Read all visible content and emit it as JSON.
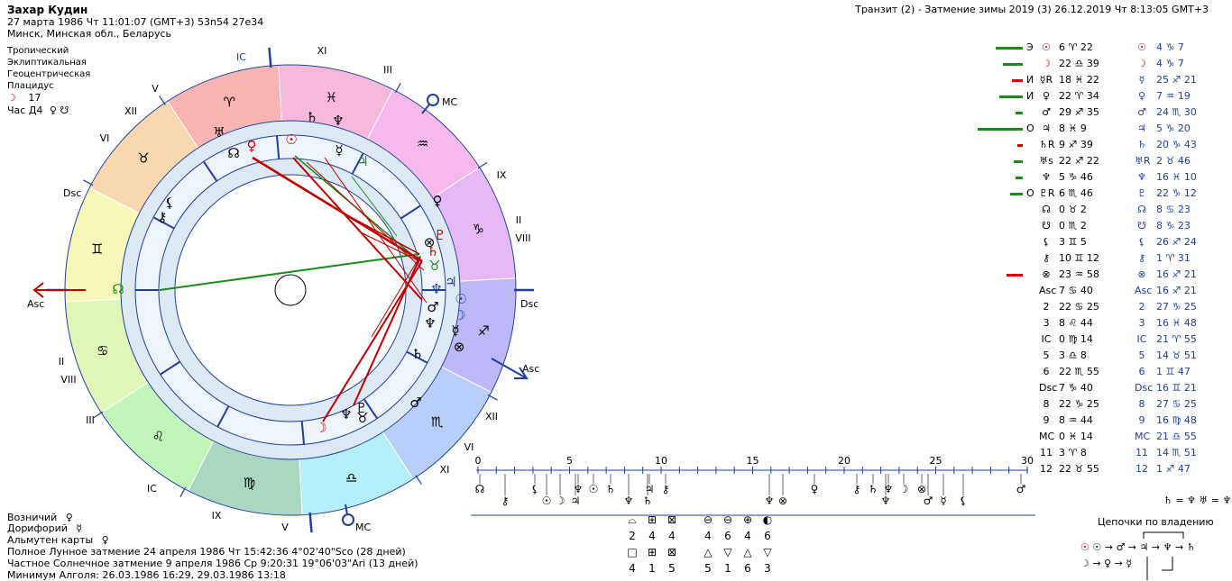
{
  "header": {
    "name": "Захар Кудин",
    "datetime": "27 марта 1986  Чт  11:01:07 (GMT+3) 53n54  27e34",
    "place": "Минск, Минская обл., Беларусь",
    "transit": "Транзит (2) - Затмение зимы 2019 (3) 26.12.2019  Чт  8:13:05 GMT+3"
  },
  "settings": {
    "zodiac": "Тропический",
    "coords": "Эклиптикальная",
    "center": "Геоцентрическая",
    "houses": "Плацидус",
    "moon_glyph": "☽",
    "moon_value": "17",
    "hour_label": "Час Д4",
    "hour_glyphs": "♀ ☋"
  },
  "bottom_info": {
    "ruler_label": "Возничий",
    "ruler_glyph": "♀",
    "doryphory_label": "Дорифорий",
    "doryphory_glyph": "☿",
    "almuten_label": "Альмутен карты",
    "almuten_glyph": "♀",
    "eclipse_lunar": "Полное Лунное затмение 24 апреля 1986 Чт 15:42:36  4°02'40\"Sco (28 дней)",
    "eclipse_solar": "Частное Солнечное затмение 9 апреля 1986 Ср  9:20:31 19°06'03\"Ari (13 дней)",
    "algol": "Минимум Алголя: 26.03.1986 16:29,  29.03.1986 13:18"
  },
  "wheel_labels": {
    "asc_left": "Asc",
    "dsc_left": "Dsc",
    "ic_top": "IC",
    "mc_right": "MC",
    "dsc_right": "Dsc",
    "asc_right": "Asc",
    "ic_bottom": "IC",
    "mc_bottom": "MC",
    "houses_outer": [
      "XI",
      "III",
      "IX",
      "II",
      "VIII",
      "XII",
      "VI",
      "V",
      "IX",
      "III",
      "II",
      "VIII",
      "XII",
      "V",
      "VI",
      "XI",
      "IX"
    ]
  },
  "signs": [
    "♈",
    "♓",
    "♒",
    "♑",
    "♐",
    "♏",
    "♎",
    "♍",
    "♌",
    "♋",
    "♊",
    "♉"
  ],
  "planets_table": [
    {
      "mark": "Э",
      "n_glyph": "☉",
      "n_pos": "6 ♈ 22",
      "t_glyph": "☉",
      "t_pos": "4 ♑ 7"
    },
    {
      "mark": "",
      "n_glyph": "☽",
      "n_pos": "22 ♎ 39",
      "t_glyph": "☽",
      "t_pos": "4 ♑ 7"
    },
    {
      "mark": "И",
      "n_glyph": "☿R",
      "n_pos": "18 ♓ 22",
      "t_glyph": "☿",
      "t_pos": "25 ♐ 21"
    },
    {
      "mark": "И",
      "n_glyph": "♀",
      "n_pos": "22 ♈ 34",
      "t_glyph": "♀",
      "t_pos": "7 ♒ 19"
    },
    {
      "mark": "",
      "n_glyph": "♂",
      "n_pos": "29 ♐ 35",
      "t_glyph": "♂",
      "t_pos": "24 ♏ 30"
    },
    {
      "mark": "О",
      "n_glyph": "♃",
      "n_pos": "8 ♓ 9",
      "t_glyph": "♃",
      "t_pos": "5 ♑ 20"
    },
    {
      "mark": "",
      "n_glyph": "♄R",
      "n_pos": "9 ♐ 39",
      "t_glyph": "♄",
      "t_pos": "20 ♑ 43"
    },
    {
      "mark": "",
      "n_glyph": "♅s",
      "n_pos": "22 ♐ 22",
      "t_glyph": "♅R",
      "t_pos": "2 ♉ 46"
    },
    {
      "mark": "",
      "n_glyph": "♆",
      "n_pos": "5 ♑ 46",
      "t_glyph": "♆",
      "t_pos": "16 ♓ 10"
    },
    {
      "mark": "О",
      "n_glyph": "♇R",
      "n_pos": "6 ♏ 46",
      "t_glyph": "♇",
      "t_pos": "22 ♑ 12"
    },
    {
      "mark": "",
      "n_glyph": "☊",
      "n_pos": "0 ♉ 2",
      "t_glyph": "☊",
      "t_pos": "8 ♋ 23"
    },
    {
      "mark": "",
      "n_glyph": "☋",
      "n_pos": "0 ♏ 2",
      "t_glyph": "☋",
      "t_pos": "8 ♑ 23"
    },
    {
      "mark": "",
      "n_glyph": "⚸",
      "n_pos": "3 ♊ 5",
      "t_glyph": "⚸",
      "t_pos": "26 ♐ 24"
    },
    {
      "mark": "",
      "n_glyph": "⚷",
      "n_pos": "10 ♊ 12",
      "t_glyph": "⚷",
      "t_pos": "1 ♈ 31"
    },
    {
      "mark": "",
      "n_glyph": "⊗",
      "n_pos": "23 ♒ 58",
      "t_glyph": "⊗",
      "t_pos": "16 ♐ 21"
    },
    {
      "mark": "",
      "n_glyph": "Asc",
      "n_pos": "7 ♋ 40",
      "t_glyph": "Asc",
      "t_pos": "16 ♐ 21"
    },
    {
      "mark": "",
      "n_glyph": "2",
      "n_pos": "22 ♋ 25",
      "t_glyph": "2",
      "t_pos": "27 ♑ 25"
    },
    {
      "mark": "",
      "n_glyph": "3",
      "n_pos": "8 ♌ 44",
      "t_glyph": "3",
      "t_pos": "16 ♓ 48"
    },
    {
      "mark": "",
      "n_glyph": "IC",
      "n_pos": "0 ♍ 14",
      "t_glyph": "IC",
      "t_pos": "21 ♈ 55"
    },
    {
      "mark": "",
      "n_glyph": "5",
      "n_pos": "3 ♎ 8",
      "t_glyph": "5",
      "t_pos": "14 ♉ 51"
    },
    {
      "mark": "",
      "n_glyph": "6",
      "n_pos": "22 ♏ 55",
      "t_glyph": "6",
      "t_pos": "1 ♊ 47"
    },
    {
      "mark": "",
      "n_glyph": "Dsc",
      "n_pos": "7 ♑ 40",
      "t_glyph": "Dsc",
      "t_pos": "16 ♊ 21"
    },
    {
      "mark": "",
      "n_glyph": "8",
      "n_pos": "22 ♑ 25",
      "t_glyph": "8",
      "t_pos": "27 ♋ 25"
    },
    {
      "mark": "",
      "n_glyph": "9",
      "n_pos": "8 ♒ 44",
      "t_glyph": "9",
      "t_pos": "16 ♍ 48"
    },
    {
      "mark": "",
      "n_glyph": "MC",
      "n_pos": "0 ♓ 14",
      "t_glyph": "MC",
      "t_pos": "21 ♎ 55"
    },
    {
      "mark": "",
      "n_glyph": "11",
      "n_pos": "3 ♈ 8",
      "t_glyph": "11",
      "t_pos": "14 ♏ 51"
    },
    {
      "mark": "",
      "n_glyph": "12",
      "n_pos": "22 ♉ 55",
      "t_glyph": "12",
      "t_pos": "1 ♐ 47"
    }
  ],
  "scale": {
    "ticks": [
      "0",
      "5",
      "10",
      "15",
      "20",
      "25",
      "30"
    ]
  },
  "aspect_counts": {
    "row1_symbols": [
      "⌓",
      "⊞",
      "⊠",
      "⊖",
      "⊖",
      "⊕",
      "◐"
    ],
    "row1_values": [
      "2",
      "4",
      "4",
      "4",
      "6",
      "4",
      "6"
    ],
    "row2_symbols": [
      "□",
      "⊞",
      "⊠",
      "△",
      "▽",
      "△",
      "▽"
    ],
    "row2_values": [
      "4",
      "1",
      "5",
      "5",
      "1",
      "6",
      "3"
    ]
  },
  "chains": {
    "formula": "♄ = ♆  ♅ = ♆",
    "title": "Цепочки по владению",
    "line1": "☉ → ♂ → ♃ → ♆ → ♄",
    "line2": "☽ → ♀ → ☿"
  }
}
